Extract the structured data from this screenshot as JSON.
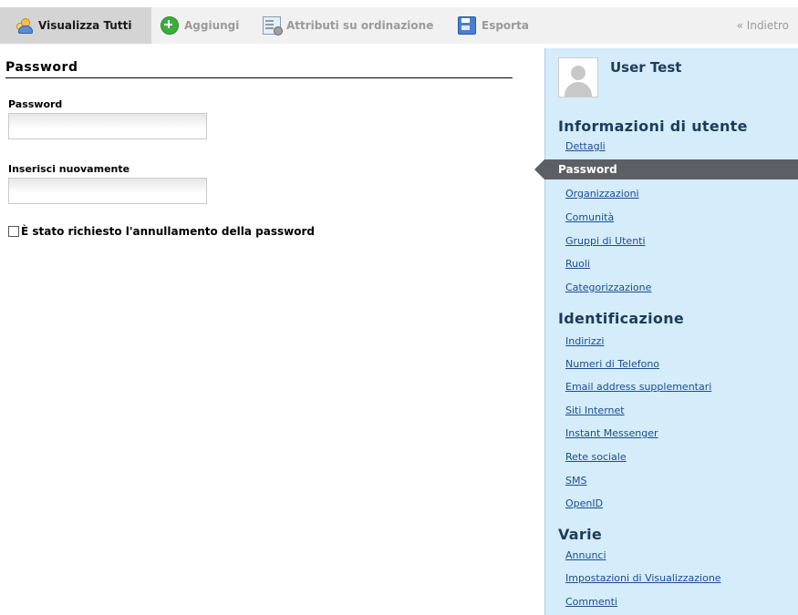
{
  "toolbar": {
    "view_all": "Visualizza Tutti",
    "add": "Aggiungi",
    "attributes": "Attributi su ordinazione",
    "export": "Esporta",
    "back": "« Indietro"
  },
  "form": {
    "section_title": "Password",
    "password_label": "Password",
    "password_value": "",
    "repeat_label": "Inserisci nuovamente",
    "repeat_value": "",
    "reset_checkbox_label": "È stato richiesto l'annullamento della password",
    "reset_checked": false
  },
  "sidebar": {
    "user_name": "User Test",
    "groups": [
      {
        "title": "Informazioni di utente",
        "items": [
          "Dettagli",
          "Password",
          "Organizzazioni",
          "Comunità",
          "Gruppi di Utenti",
          "Ruoli",
          "Categorizzazione"
        ]
      },
      {
        "title": "Identificazione",
        "items": [
          "Indirizzi",
          "Numeri di Telefono",
          "Email address supplementari",
          "Siti Internet",
          "Instant Messenger",
          "Rete sociale",
          "SMS",
          "OpenID"
        ]
      },
      {
        "title": "Varie",
        "items": [
          "Annunci",
          "Impostazioni di Visualizzazione",
          "Commenti"
        ]
      }
    ],
    "active_item": "Password"
  },
  "colors": {
    "sidebar_bg": "#d5ecfa",
    "active_item_bg": "#5c6064",
    "link": "#1a4d8f",
    "heading": "#1d3b5a"
  }
}
